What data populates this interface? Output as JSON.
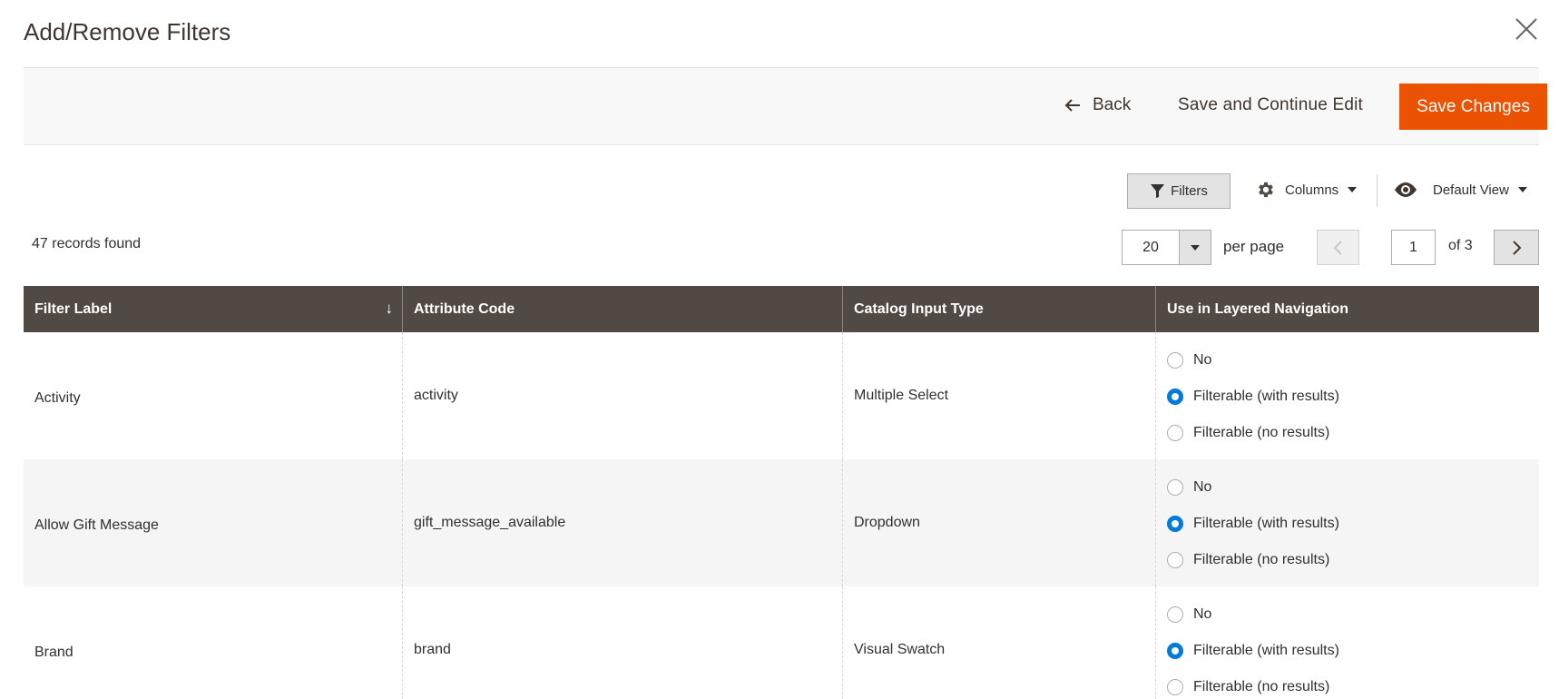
{
  "modal": {
    "title": "Add/Remove Filters"
  },
  "actions": {
    "back_label": "Back",
    "save_continue_label": "Save and Continue Edit",
    "save_changes_label": "Save Changes"
  },
  "toolbar": {
    "filters_label": "Filters",
    "columns_label": "Columns",
    "view_label": "Default View"
  },
  "pager": {
    "records_found": "47 records found",
    "per_page_value": "20",
    "per_page_label": "per page",
    "current_page": "1",
    "page_of": "of 3"
  },
  "grid": {
    "headers": [
      "Filter Label",
      "Attribute Code",
      "Catalog Input Type",
      "Use in Layered Navigation"
    ],
    "sort_indicator": "↓",
    "radio_options": [
      "No",
      "Filterable (with results)",
      "Filterable (no results)"
    ],
    "rows": [
      {
        "label": "Activity",
        "code": "activity",
        "input_type": "Multiple Select",
        "selected": 1
      },
      {
        "label": "Allow Gift Message",
        "code": "gift_message_available",
        "input_type": "Dropdown",
        "selected": 1
      },
      {
        "label": "Brand",
        "code": "brand",
        "input_type": "Visual Swatch",
        "selected": 1
      }
    ]
  },
  "colors": {
    "primary_button": "#eb5202",
    "grid_header": "#514943",
    "radio_checked": "#007bdb"
  }
}
